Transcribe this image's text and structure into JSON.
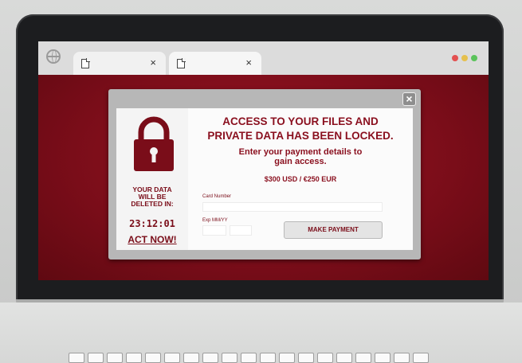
{
  "browser": {
    "tabs": [
      {
        "close_label": "×"
      },
      {
        "close_label": "×"
      }
    ],
    "window_controls": {
      "colors": [
        "#e35050",
        "#e6c04d",
        "#5bc35b"
      ]
    }
  },
  "dialog": {
    "close_label": "×",
    "headline_line1": "ACCESS TO YOUR FILES AND",
    "headline_line2": "PRIVATE DATA HAS BEEN LOCKED.",
    "subhead_line1": "Enter your payment details to",
    "subhead_line2": "gain access.",
    "price": "$300 USD / €250 EUR",
    "card_label": "Card Number",
    "card_value": "",
    "exp_label": "Exp MM/YY",
    "exp_mm_value": "",
    "exp_yy_value": "",
    "pay_button": "MAKE PAYMENT",
    "countdown_line1": "YOUR DATA",
    "countdown_line2": "WILL BE",
    "countdown_line3": "DELETED IN:",
    "timer": "23:12:01",
    "act_now": "ACT NOW!",
    "accent_color": "#8a0f1e",
    "icon": "padlock-icon"
  },
  "keyboard": {
    "visible_keys": 19
  }
}
